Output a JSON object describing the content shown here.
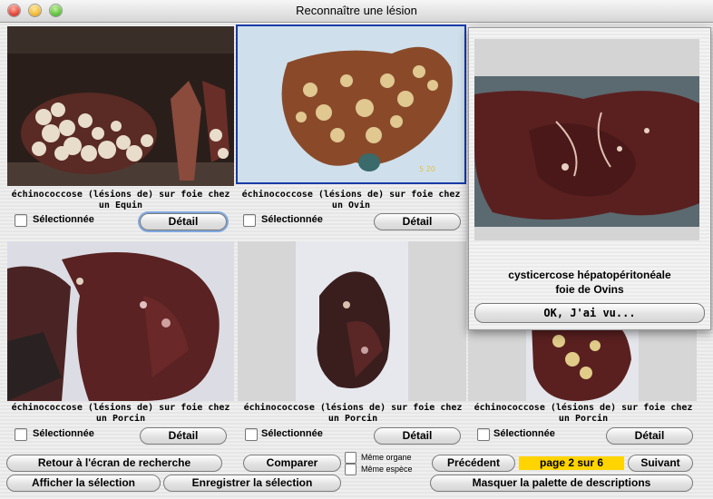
{
  "window": {
    "title": "Reconnaître une lésion"
  },
  "results": [
    {
      "caption": "échinococcose (lésions de) sur foie chez un Equin",
      "select_label": "Sélectionnée",
      "detail_label": "Détail"
    },
    {
      "caption": "échinococcose (lésions de) sur foie chez un Ovin",
      "select_label": "Sélectionnée",
      "detail_label": "Détail",
      "photo_marker": "5   20"
    },
    {
      "caption": "échinococcose (lésions de) sur foie chez un Porcin",
      "select_label": "Sélectionnée",
      "detail_label": "Détail"
    },
    {
      "caption": "échinococcose (lésions de) sur foie chez un Porcin",
      "select_label": "Sélectionnée",
      "detail_label": "Détail"
    },
    {
      "caption": "échinococcose (lésions de) sur foie chez un Porcin",
      "select_label": "Sélectionnée",
      "detail_label": "Détail"
    }
  ],
  "palette": {
    "title_line1": "cysticercose hépatopéritonéale",
    "title_line2": "foie de Ovins",
    "ok_label": "OK, J'ai vu..."
  },
  "footer": {
    "back_label": "Retour à l'écran de recherche",
    "compare_label": "Comparer",
    "same_organ_label": "Même organe",
    "same_species_label": "Même espèce",
    "prev_label": "Précédent",
    "page_label": "page 2 sur 6",
    "next_label": "Suivant",
    "show_selection_label": "Afficher la sélection",
    "save_selection_label": "Enregistrer la sélection",
    "hide_palette_label": "Masquer la palette de descriptions"
  },
  "colors": {
    "page_indicator": "#ffd400",
    "selected_border": "#1a3aa8"
  }
}
